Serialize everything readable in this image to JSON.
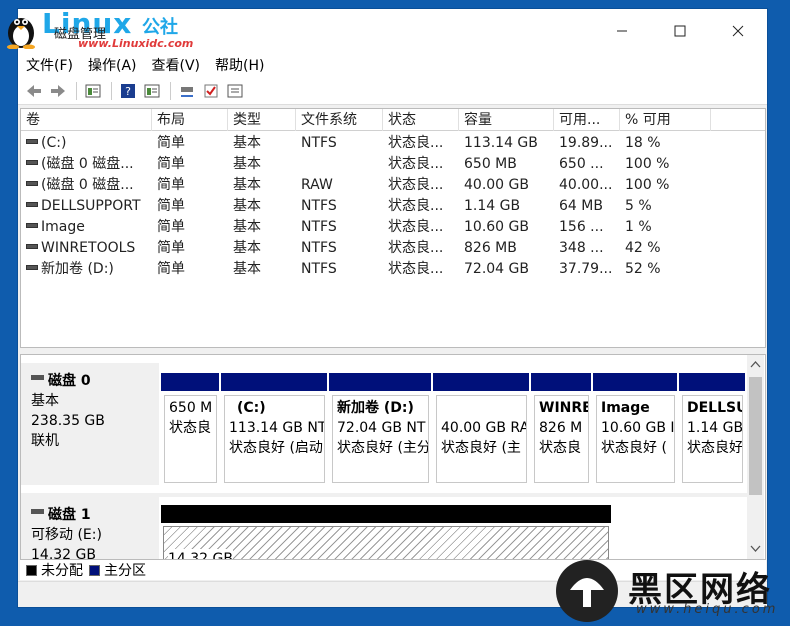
{
  "window": {
    "title": "磁盘管理",
    "logo_brand": "Linux",
    "logo_brand_cn": "公社",
    "logo_site": "www.Linuxidc.com"
  },
  "menu": [
    "文件(F)",
    "操作(A)",
    "查看(V)",
    "帮助(H)"
  ],
  "toolbar_icons": [
    "back-arrow-icon",
    "forward-arrow-icon",
    "properties-icon",
    "help-icon",
    "volume-list-icon",
    "connect-icon",
    "check-icon",
    "settings-icon"
  ],
  "columns": [
    "卷",
    "布局",
    "类型",
    "文件系统",
    "状态",
    "容量",
    "可用...",
    "% 可用"
  ],
  "volumes": [
    [
      "(C:)",
      "简单",
      "基本",
      "NTFS",
      "状态良...",
      "113.14 GB",
      "19.89...",
      "18 %"
    ],
    [
      "(磁盘 0 磁盘...",
      "简单",
      "基本",
      "",
      "状态良...",
      "650 MB",
      "650 ...",
      "100 %"
    ],
    [
      "(磁盘 0 磁盘...",
      "简单",
      "基本",
      "RAW",
      "状态良...",
      "40.00 GB",
      "40.00...",
      "100 %"
    ],
    [
      "DELLSUPPORT",
      "简单",
      "基本",
      "NTFS",
      "状态良...",
      "1.14 GB",
      "64 MB",
      "5 %"
    ],
    [
      "Image",
      "简单",
      "基本",
      "NTFS",
      "状态良...",
      "10.60 GB",
      "156 ...",
      "1 %"
    ],
    [
      "WINRETOOLS",
      "简单",
      "基本",
      "NTFS",
      "状态良...",
      "826 MB",
      "348 ...",
      "42 %"
    ],
    [
      "新加卷 (D:)",
      "简单",
      "基本",
      "NTFS",
      "状态良...",
      "72.04 GB",
      "37.79...",
      "52 %"
    ]
  ],
  "disk0": {
    "name": "磁盘 0",
    "type": "基本",
    "size": "238.35 GB",
    "status": "联机",
    "partitions": [
      {
        "name": "",
        "size": "650 M",
        "status": "状态良"
      },
      {
        "name": "(C:)",
        "size": "113.14 GB NT",
        "status": "状态良好 (启动"
      },
      {
        "name": "新加卷  (D:)",
        "size": "72.04 GB NT",
        "status": "状态良好 (主分"
      },
      {
        "name": "",
        "size": "40.00 GB RA",
        "status": "状态良好 (主"
      },
      {
        "name": "WINRE",
        "size": "826 M",
        "status": "状态良"
      },
      {
        "name": "Image",
        "size": "10.60 GB I",
        "status": "状态良好 ("
      },
      {
        "name": "DELLSU",
        "size": "1.14 GB",
        "status": "状态良好"
      }
    ]
  },
  "disk1": {
    "name": "磁盘 1",
    "type": "可移动 (E:)",
    "size": "14.32 GB",
    "partition_size": "14.32 GB"
  },
  "legend": {
    "unallocated": "未分配",
    "primary": "主分区",
    "unallocated_color": "#000000",
    "primary_color": "#00107a"
  },
  "watermark": {
    "cn": "黑区网络",
    "url": "www.heiqu.com"
  }
}
